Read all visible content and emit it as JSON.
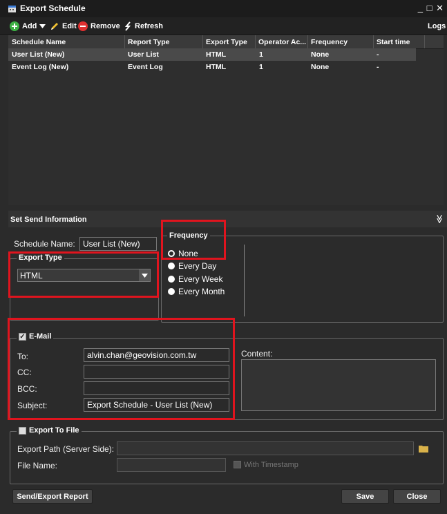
{
  "window": {
    "title": "Export Schedule",
    "controls": "_ □ ✕"
  },
  "toolbar": {
    "add": "Add",
    "edit": "Edit",
    "remove": "Remove",
    "refresh": "Refresh",
    "logs": "Logs"
  },
  "grid": {
    "headers": [
      "Schedule Name",
      "Report Type",
      "Export Type",
      "Operator Ac...",
      "Frequency",
      "Start time"
    ],
    "rows": [
      [
        "User List (New)",
        "User List",
        "HTML",
        "1",
        "None",
        "-"
      ],
      [
        "Event Log (New)",
        "Event Log",
        "HTML",
        "1",
        "None",
        "-"
      ]
    ]
  },
  "panel": {
    "title": "Set Send Information",
    "collapse_icon": "≫"
  },
  "form": {
    "schedule_name_label": "Schedule Name:",
    "schedule_name_value": "User List (New)",
    "export_type_legend": "Export Type",
    "export_type_value": "HTML",
    "frequency_legend": "Frequency",
    "frequency_options": [
      "None",
      "Every Day",
      "Every Week",
      "Every Month"
    ],
    "email_legend": "E-Mail",
    "to_label": "To:",
    "to_value": "alvin.chan@geovision.com.tw",
    "cc_label": "CC:",
    "cc_value": "",
    "bcc_label": "BCC:",
    "bcc_value": "",
    "subject_label": "Subject:",
    "subject_value": "Export Schedule - User List (New)",
    "content_label": "Content:",
    "export_file_legend": "Export To File",
    "export_path_label": "Export Path (Server Side):",
    "export_path_value": "",
    "file_name_label": "File Name:",
    "file_name_value": "",
    "timestamp_label": "With Timestamp"
  },
  "buttons": {
    "send": "Send/Export Report",
    "save": "Save",
    "close": "Close"
  },
  "colors": {
    "highlight": "#e0141e",
    "add": "#3cb043",
    "remove": "#e03030"
  }
}
